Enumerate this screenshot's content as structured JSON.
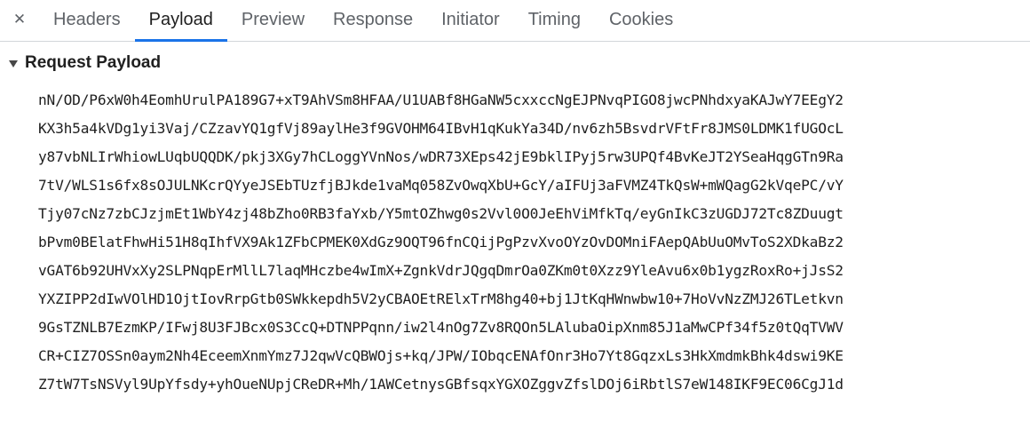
{
  "tabs": {
    "close_glyph": "✕",
    "items": [
      {
        "label": "Headers",
        "active": false
      },
      {
        "label": "Payload",
        "active": true
      },
      {
        "label": "Preview",
        "active": false
      },
      {
        "label": "Response",
        "active": false
      },
      {
        "label": "Initiator",
        "active": false
      },
      {
        "label": "Timing",
        "active": false
      },
      {
        "label": "Cookies",
        "active": false
      }
    ]
  },
  "section": {
    "title": "Request Payload",
    "expanded": true
  },
  "payload": {
    "lines": [
      "nN/OD/P6xW0h4EomhUrulPA189G7+xT9AhVSm8HFAA/U1UABf8HGaNW5cxxccNgEJPNvqPIGO8jwcPNhdxyaKAJwY7EEgY2",
      "KX3h5a4kVDg1yi3Vaj/CZzavYQ1gfVj89aylHe3f9GVOHM64IBvH1qKukYa34D/nv6zh5BsvdrVFtFr8JMS0LDMK1fUGOcL",
      "y87vbNLIrWhiowLUqbUQQDK/pkj3XGy7hCLoggYVnNos/wDR73XEps42jE9bklIPyj5rw3UPQf4BvKeJT2YSeaHqgGTn9Ra",
      "7tV/WLS1s6fx8sOJULNKcrQYyeJSEbTUzfjBJkde1vaMq058ZvOwqXbU+GcY/aIFUj3aFVMZ4TkQsW+mWQagG2kVqePC/vY",
      "Tjy07cNz7zbCJzjmEt1WbY4zj48bZho0RB3faYxb/Y5mtOZhwg0s2Vvl0O0JeEhViMfkTq/eyGnIkC3zUGDJ72Tc8ZDuugt",
      "bPvm0BElatFhwHi51H8qIhfVX9Ak1ZFbCPMEK0XdGz9OQT96fnCQijPgPzvXvoOYzOvDOMniFAepQAbUuOMvToS2XDkaBz2",
      "vGAT6b92UHVxXy2SLPNqpErMllL7laqMHczbe4wImX+ZgnkVdrJQgqDmrOa0ZKm0t0Xzz9YleAvu6x0b1ygzRoxRo+jJsS2",
      "YXZIPP2dIwVOlHD1OjtIovRrpGtb0SWkkepdh5V2yCBAOEtRElxTrM8hg40+bj1JtKqHWnwbw10+7HoVvNzZMJ26TLetkvn",
      "9GsTZNLB7EzmKP/IFwj8U3FJBcx0S3CcQ+DTNPPqnn/iw2l4nOg7Zv8RQOn5LAlubaOipXnm85J1aMwCPf34f5z0tQqTVWV",
      "CR+CIZ7OSSn0aym2Nh4EceemXnmYmz7J2qwVcQBWOjs+kq/JPW/IObqcENAfOnr3Ho7Yt8GqzxLs3HkXmdmkBhk4dswi9KE",
      "Z7tW7TsNSVyl9UpYfsdy+yhOueNUpjCReDR+Mh/1AWCetnysGBfsqxYGXOZggvZfslDOj6iRbtlS7eW148IKF9EC06CgJ1d"
    ]
  }
}
